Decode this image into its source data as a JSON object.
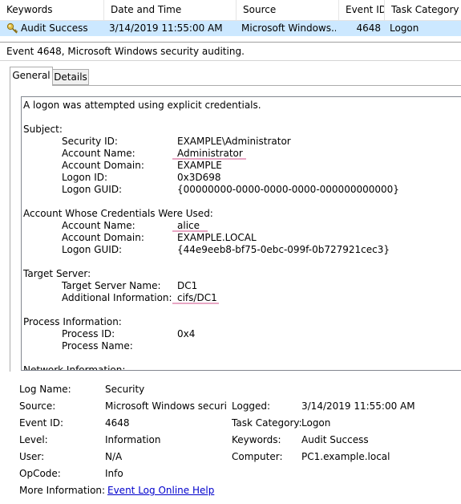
{
  "event_list": {
    "columns": [
      "Keywords",
      "Date and Time",
      "Source",
      "Event ID",
      "Task Category"
    ],
    "row": {
      "keywords": "Audit Success",
      "date_time": "3/14/2019 11:55:00 AM",
      "source": "Microsoft Windows...",
      "event_id": "4648",
      "task_category": "Logon"
    },
    "icon": "key-icon"
  },
  "detail_title": "Event 4648, Microsoft Windows security auditing.",
  "tabs": [
    "General",
    "Details"
  ],
  "description": {
    "intro": "A logon was attempted using explicit credentials.",
    "subject": {
      "header": "Subject:",
      "security_id_label": "Security ID:",
      "security_id": "EXAMPLE\\Administrator",
      "account_name_label": "Account Name:",
      "account_name": "Administrator",
      "account_domain_label": "Account Domain:",
      "account_domain": "EXAMPLE",
      "logon_id_label": "Logon ID:",
      "logon_id": "0x3D698",
      "logon_guid_label": "Logon GUID:",
      "logon_guid": "{00000000-0000-0000-0000-000000000000}"
    },
    "credentials": {
      "header": "Account Whose Credentials Were Used:",
      "account_name_label": "Account Name:",
      "account_name": "alice",
      "account_domain_label": "Account Domain:",
      "account_domain": "EXAMPLE.LOCAL",
      "logon_guid_label": "Logon GUID:",
      "logon_guid": "{44e9eeb8-bf75-0ebc-099f-0b727921cec3}"
    },
    "target": {
      "header": "Target Server:",
      "server_name_label": "Target Server Name:",
      "server_name": "DC1",
      "additional_label": "Additional Information:",
      "additional": "cifs/DC1"
    },
    "process": {
      "header": "Process Information:",
      "process_id_label": "Process ID:",
      "process_id": "0x4",
      "process_name_label": "Process Name:",
      "process_name": ""
    },
    "network_header_partial": "Network Information:"
  },
  "properties": {
    "log_name_label": "Log Name:",
    "log_name": "Security",
    "source_label": "Source:",
    "source": "Microsoft Windows security",
    "logged_label": "Logged:",
    "logged": "3/14/2019 11:55:00 AM",
    "event_id_label": "Event ID:",
    "event_id": "4648",
    "task_category_label": "Task Category:",
    "task_category": "Logon",
    "level_label": "Level:",
    "level": "Information",
    "keywords_label": "Keywords:",
    "keywords": "Audit Success",
    "user_label": "User:",
    "user": "N/A",
    "computer_label": "Computer:",
    "computer": "PC1.example.local",
    "opcode_label": "OpCode:",
    "opcode": "Info",
    "more_info_label": "More Information:",
    "more_info_link": "Event Log Online Help"
  },
  "colors": {
    "selected_row": "#cce8ff",
    "highlight_underline": "#e8a7c4",
    "link": "#0000cc"
  }
}
